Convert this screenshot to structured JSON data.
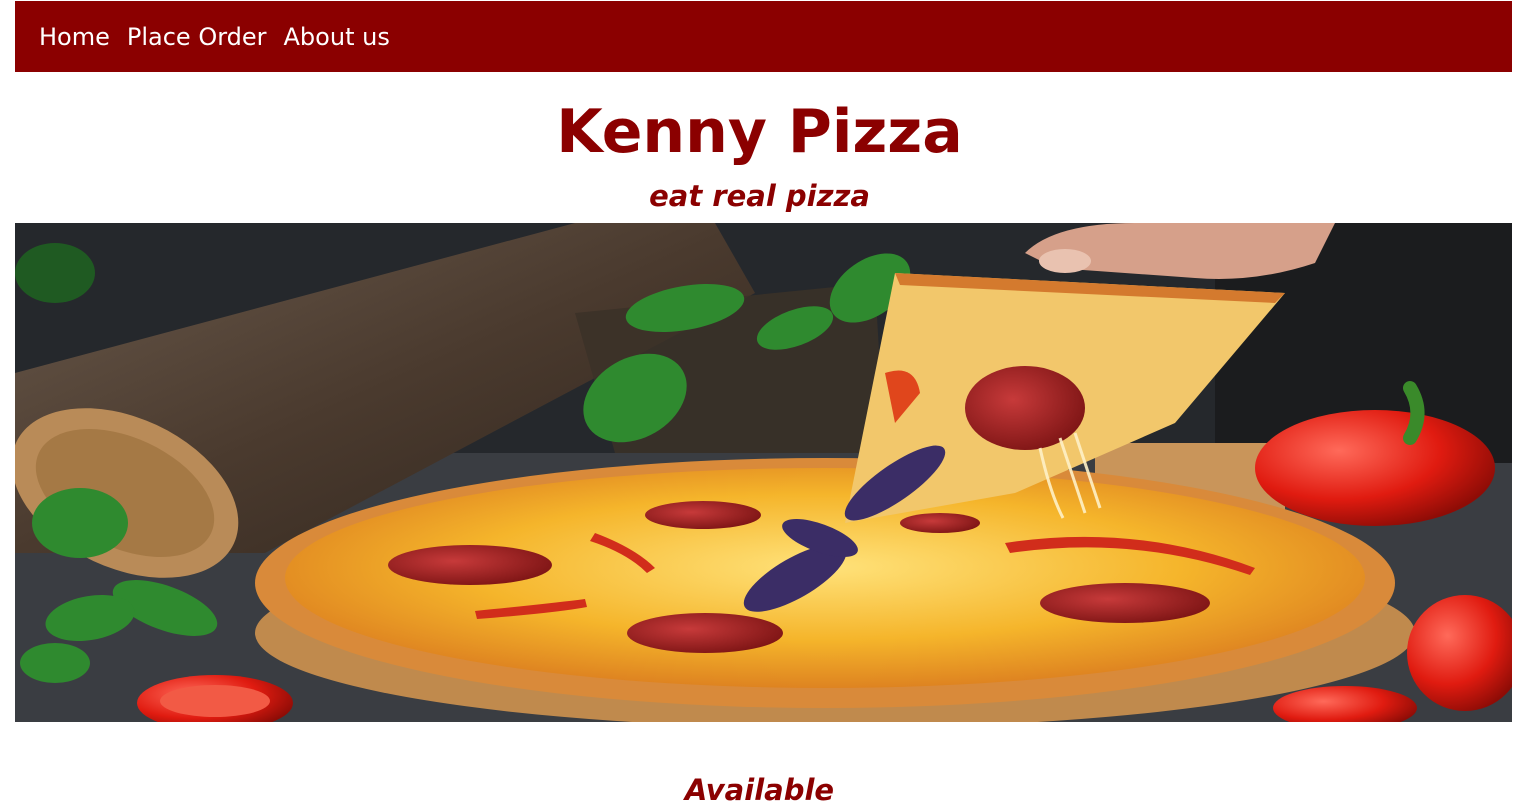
{
  "nav": {
    "items": [
      {
        "label": "Home"
      },
      {
        "label": "Place Order"
      },
      {
        "label": "About us"
      }
    ]
  },
  "header": {
    "title": "Kenny Pizza",
    "tagline": "eat real pizza"
  },
  "hero": {
    "image": "pepperoni-pizza-photo"
  },
  "section": {
    "heading": "Available"
  },
  "colors": {
    "brand": "#8b0000",
    "nav_text": "#ffffff"
  }
}
